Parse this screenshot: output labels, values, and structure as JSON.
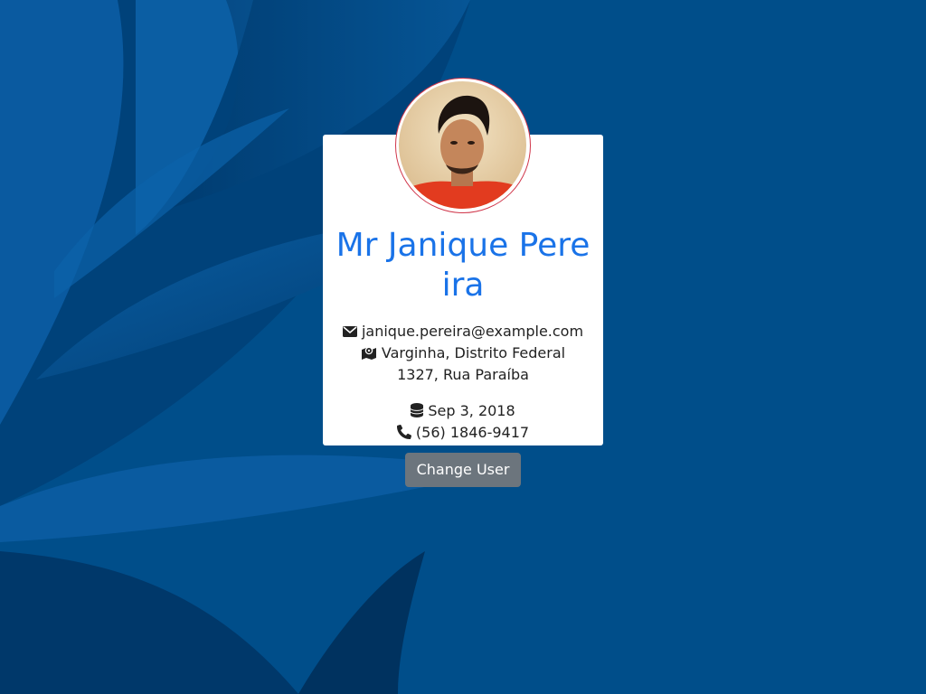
{
  "user": {
    "name": "Mr Janique Pereira",
    "email": "janique.pereira@example.com",
    "location": "Varginha, Distrito Federal",
    "street": "1327, Rua Paraíba",
    "registered": "Sep 3, 2018",
    "phone": "(56) 1846-9417"
  },
  "icons": {
    "email": "envelope-icon",
    "location": "map-marker-icon",
    "registered": "database-icon",
    "phone": "phone-icon"
  },
  "actions": {
    "change_user_label": "Change User"
  },
  "colors": {
    "background": "#004e8a",
    "name": "#1a73e8",
    "avatar_border": "#d0364a",
    "button": "#6c757d",
    "card": "#ffffff"
  }
}
